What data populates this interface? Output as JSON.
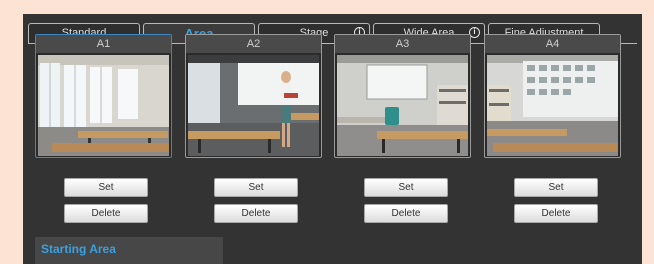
{
  "tabs": [
    {
      "label": "Standard",
      "active": false,
      "info": false
    },
    {
      "label": "Area",
      "active": true,
      "info": false
    },
    {
      "label": "Stage",
      "active": false,
      "info": true
    },
    {
      "label": "Wide Area",
      "active": false,
      "info": true
    },
    {
      "label": "Fine Adjustment",
      "active": false,
      "info": false
    }
  ],
  "icons": {
    "info": "info-circle-icon"
  },
  "areas": [
    {
      "name": "A1",
      "set_label": "Set",
      "delete_label": "Delete"
    },
    {
      "name": "A2",
      "set_label": "Set",
      "delete_label": "Delete"
    },
    {
      "name": "A3",
      "set_label": "Set",
      "delete_label": "Delete"
    },
    {
      "name": "A4",
      "set_label": "Set",
      "delete_label": "Delete"
    }
  ],
  "starting_area": {
    "title": "Starting Area"
  },
  "colors": {
    "accent": "#3aa0e0",
    "panel": "#333333",
    "page": "#fde3d3"
  }
}
